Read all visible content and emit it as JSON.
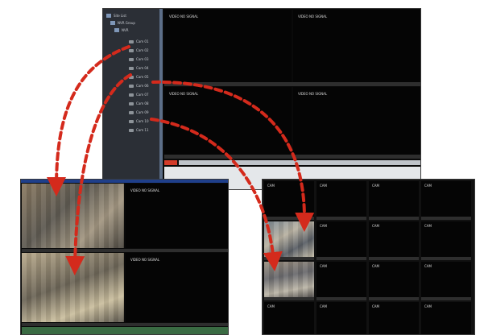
{
  "main_window": {
    "tree": {
      "root_label": "Site List",
      "group_label": "NVR Group",
      "device_label": "NVR",
      "cameras": [
        "Cam 01",
        "Cam 02",
        "Cam 03",
        "Cam 04",
        "Cam 05",
        "Cam 06",
        "Cam 07",
        "Cam 08",
        "Cam 09",
        "Cam 10",
        "Cam 11"
      ]
    },
    "tiles": [
      "VIDEO NO SIGNAL",
      "VIDEO NO SIGNAL",
      "VIDEO NO SIGNAL",
      "VIDEO NO SIGNAL"
    ]
  },
  "left_window": {
    "tiles": [
      "",
      "VIDEO NO SIGNAL",
      "",
      "VIDEO NO SIGNAL"
    ]
  },
  "right_window": {
    "tiles": [
      "CAM",
      "CAM",
      "CAM",
      "CAM",
      "",
      "CAM",
      "CAM",
      "CAM",
      "",
      "CAM",
      "CAM",
      "CAM",
      "CAM",
      "CAM",
      "CAM",
      "CAM"
    ]
  },
  "colors": {
    "arrow": "#d42a1c",
    "panel": "#0a0a0a",
    "tree_bg": "#2b2f36"
  }
}
